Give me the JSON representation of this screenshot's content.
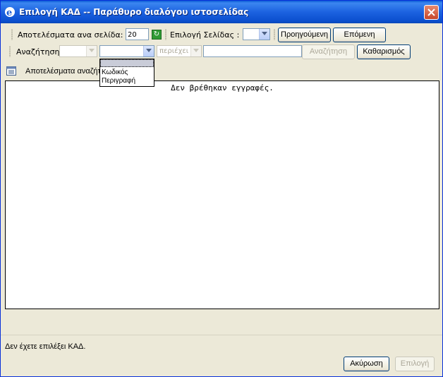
{
  "window": {
    "title": "Επιλογή ΚΑΔ -- Παράθυρο διαλόγου ιστοσελίδας"
  },
  "paging": {
    "results_per_page_label": "Αποτελέσματα ανα σελίδα:",
    "results_per_page_value": "20",
    "page_select_label": "Επιλογή Σελίδας :",
    "page_select_value": "",
    "previous_label": "Προηγούμενη",
    "next_label": "Επόμενη"
  },
  "search": {
    "label": "Αναζήτηση:",
    "field_select_value": "",
    "field_options": [
      "",
      "Κωδικός",
      "Περιγραφή"
    ],
    "operator_value": "περιέχει",
    "text_value": "",
    "search_button_label": "Αναζήτηση",
    "clear_button_label": "Καθαρισμός"
  },
  "results": {
    "section_label": "Αποτελέσματα αναζήτ",
    "empty_message": "Δεν βρέθηκαν εγγραφές."
  },
  "status": {
    "message": "Δεν έχετε επιλέξει ΚΑΔ."
  },
  "footer": {
    "cancel_label": "Ακύρωση",
    "select_label": "Επιλογή"
  }
}
